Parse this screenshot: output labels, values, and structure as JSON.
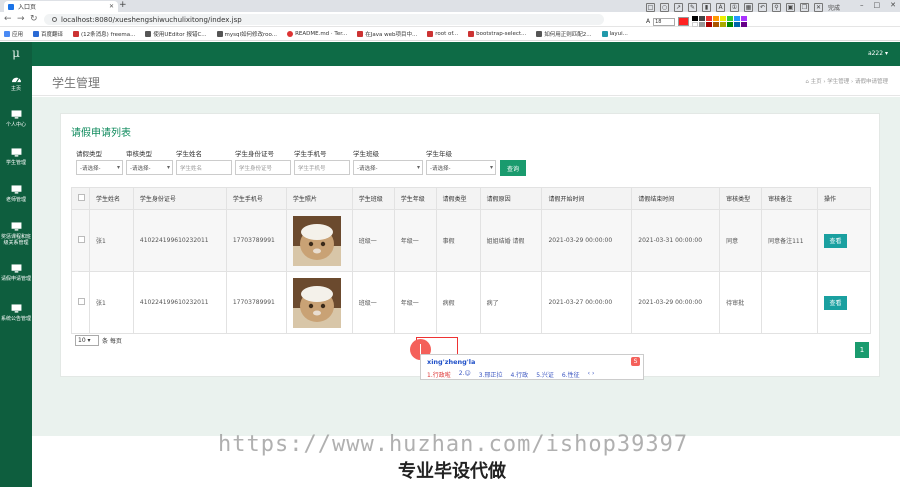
{
  "browser": {
    "tab_title": "入口页",
    "url": "localhost:8080/xueshengshiwuchulixitong/index.jsp",
    "new_tab": "+",
    "font_size": "18",
    "done_label": "完成",
    "bookmarks": [
      "应用",
      "百度翻译",
      "(12条消息) freema...",
      "使用UEditor 报错C...",
      "mysql如何修改roo...",
      "README.md · Ter...",
      "在Java web项目中...",
      "root of...",
      "bootstrap-select...",
      "如何用正则匹配2...",
      "layui..."
    ],
    "colors": {
      "tab_bar": "#dee1e6",
      "pen": "#ff2222"
    }
  },
  "app": {
    "logo": "μ",
    "user": "a222",
    "sidebar": [
      {
        "label": "主页",
        "icon": "dashboard-icon"
      },
      {
        "label": "个人中心",
        "icon": "monitor-icon"
      },
      {
        "label": "学生管理",
        "icon": "monitor-icon"
      },
      {
        "label": "老师管理",
        "icon": "monitor-icon"
      },
      {
        "label": "奖惩课程和班级关系管理",
        "icon": "monitor-icon"
      },
      {
        "label": "请假申请管理",
        "icon": "monitor-icon"
      },
      {
        "label": "系统公告管理",
        "icon": "monitor-icon"
      }
    ],
    "page_title": "学生管理",
    "breadcrumb": "主页 › 学生管理 › 请假申请管理",
    "colors": {
      "sidebar": "#0e5e3e",
      "topbar": "#0e6b46",
      "accent": "#1a9b6e"
    }
  },
  "card": {
    "title": "请假申请列表",
    "filters": {
      "leave_type": {
        "label": "请假类型",
        "value": "-请选择-"
      },
      "audit_type": {
        "label": "审核类型",
        "value": "-请选择-"
      },
      "name": {
        "label": "学生姓名",
        "placeholder": "学生姓名"
      },
      "id_card": {
        "label": "学生身份证号",
        "placeholder": "学生身份证号"
      },
      "phone": {
        "label": "学生手机号",
        "placeholder": "学生手机号"
      },
      "class": {
        "label": "学生班级",
        "value": "-请选择-"
      },
      "grade": {
        "label": "学生年级",
        "value": "-请选择-"
      },
      "search": "查询"
    },
    "columns": [
      "学生姓名",
      "学生身份证号",
      "学生手机号",
      "学生照片",
      "学生班级",
      "学生年级",
      "请假类型",
      "请假原因",
      "请假开始时间",
      "请假结束时间",
      "审核类型",
      "审核备注",
      "操作"
    ],
    "rows": [
      {
        "name": "张1",
        "id": "410224199610232011",
        "phone": "17703789991",
        "photo": "cat-photo",
        "cls": "班级一",
        "grade": "年级一",
        "type": "事假",
        "reason": "姐姐结婚 请假",
        "start": "2021-03-29 00:00:00",
        "end": "2021-03-31 00:00:00",
        "audit": "同意",
        "note": "同意备注111",
        "action": "查看"
      },
      {
        "name": "张1",
        "id": "410224199610232011",
        "phone": "17703789991",
        "photo": "cat-photo",
        "cls": "班级一",
        "grade": "年级一",
        "type": "病假",
        "reason": "病了",
        "start": "2021-03-27 00:00:00",
        "end": "2021-03-29 00:00:00",
        "audit": "待审批",
        "note": "",
        "action": "查看"
      }
    ],
    "page_size": "10",
    "page_size_suffix": "条 每页",
    "current_page": "1"
  },
  "ime": {
    "pinyin": "xing'zheng'la",
    "candidates": [
      "1.行政啦",
      "2.☺",
      "3.邢正拉",
      "4.行政",
      "5.兴证",
      "6.性征",
      "‹ ›"
    ]
  },
  "watermark": {
    "url": "https://www.huzhan.com/ishop39397",
    "caption": "专业毕设代做"
  }
}
